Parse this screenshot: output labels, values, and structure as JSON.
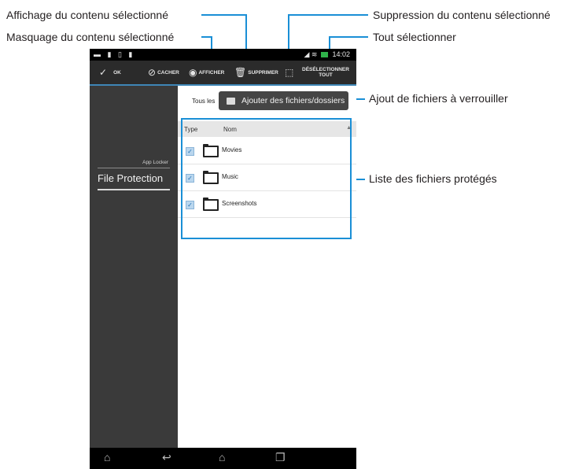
{
  "callouts": {
    "affichage": "Affichage du contenu sélectionné",
    "masquage": "Masquage du contenu sélectionné",
    "suppression": "Suppression du contenu sélectionné",
    "tout_selectionner": "Tout sélectionner",
    "ajout": "Ajout de fichiers à verrouiller",
    "liste": "Liste des fichiers protégés"
  },
  "status_bar": {
    "left_icons": "▬ ▮ ▯ ▮",
    "time": "14:02",
    "signal": "◢ ≋"
  },
  "action_bar": {
    "ok": "OK",
    "cacher": "CACHER",
    "afficher": "AFFICHER",
    "supprimer": "SUPPRIMER",
    "deselect_line1": "DÉSÉLECTIONNER",
    "deselect_line2": "TOUT"
  },
  "sidebar": {
    "section": "App Locker",
    "item": "File Protection"
  },
  "content": {
    "filter_label": "Tous les",
    "add_button": "Ajouter des fichiers/dossiers",
    "col_type": "Type",
    "col_name": "Nom",
    "rows": [
      {
        "name": "Movies"
      },
      {
        "name": "Music"
      },
      {
        "name": "Screenshots"
      }
    ]
  },
  "icons": [
    "check-icon",
    "eye-slash-icon",
    "eye-icon",
    "trash-icon",
    "select-cursor-icon",
    "plus-box-icon",
    "folder-icon",
    "home-icon",
    "back-icon",
    "recent-apps-icon",
    "sort-arrow-icon"
  ],
  "colors": {
    "accent": "#1a8fd6",
    "actionbar": "#2b2b2b",
    "sidebar": "#3a3a3a"
  }
}
